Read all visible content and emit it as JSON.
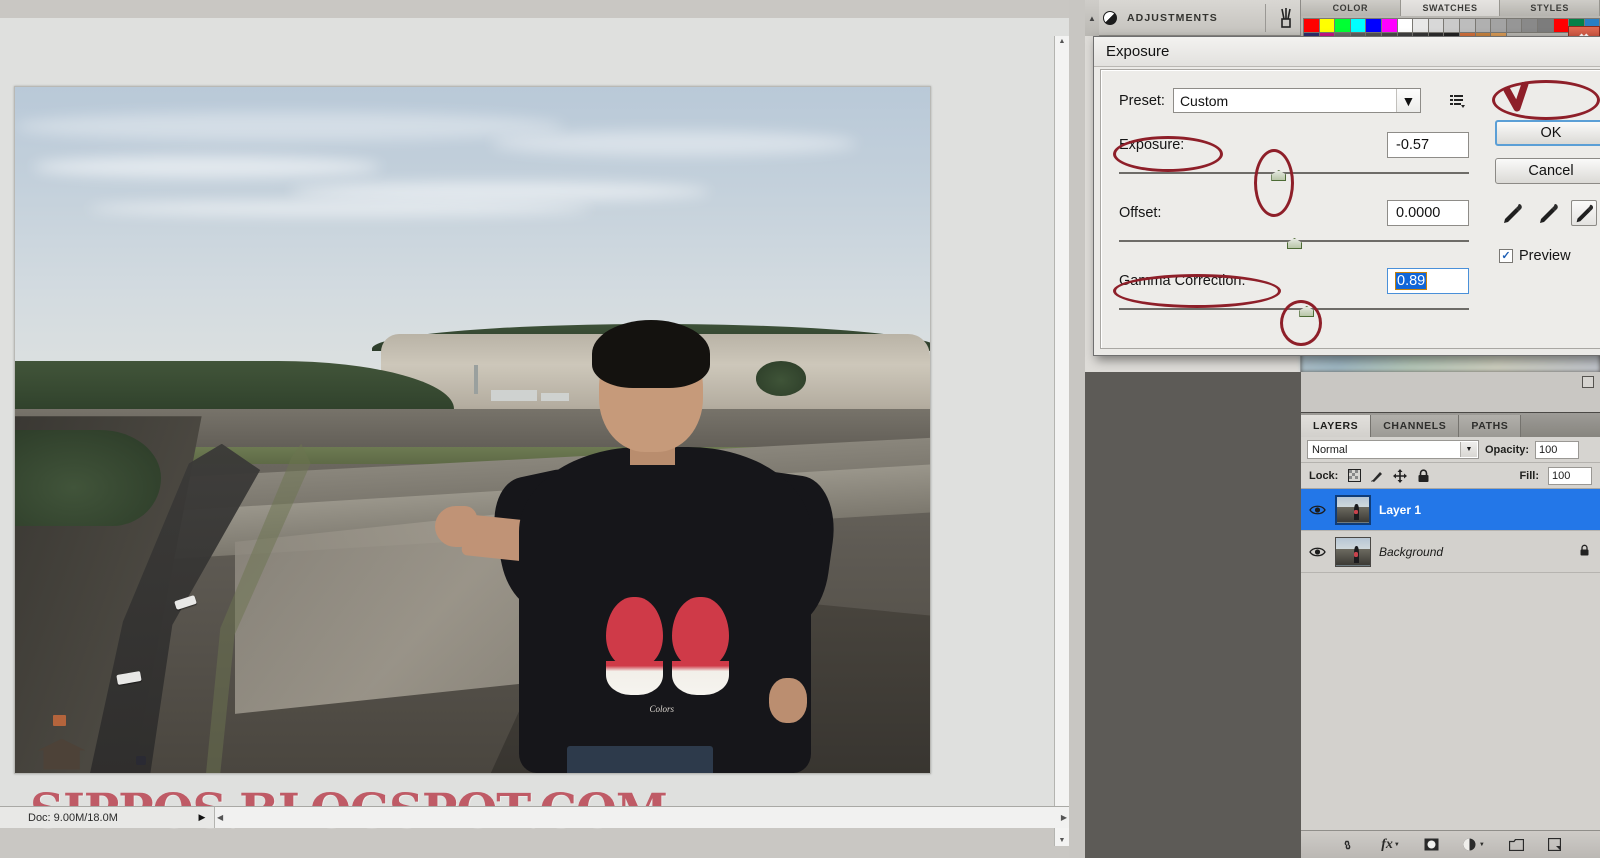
{
  "app": {
    "name": "Adobe Photoshop",
    "canvas_bg": "#c9c7c3"
  },
  "document": {
    "status_text": "Doc: 9.00M/18.0M",
    "status_arrow": "▶",
    "hscroll_left_arrow": "◀",
    "hscroll_right_arrow": "▶",
    "vscroll_up_arrow": "▲",
    "vscroll_down_arrow": "▼",
    "watermark": "SIPPOS.BLOGSPOT.COM",
    "photo_description": "Photo of a man in a black t-shirt with a red and white heart graphic standing in a limestone quarry with a winding road"
  },
  "photo": {
    "shirt_signature": "Colors"
  },
  "adjustments_strip": {
    "label": "ADJUSTMENTS",
    "icon": "half-circle-adjustment-icon",
    "brush_icon": "brush-preset-icon",
    "scroll_arrow": "▲"
  },
  "swatch_dock": {
    "tabs": [
      {
        "label": "COLOR",
        "active": false
      },
      {
        "label": "SWATCHES",
        "active": true
      },
      {
        "label": "STYLES",
        "active": false
      }
    ],
    "swatches": [
      "#ff0000",
      "#ffff00",
      "#00ff33",
      "#00ffff",
      "#0000ff",
      "#ff00ff",
      "#ffffff",
      "#e8e8e8",
      "#d8d8d8",
      "#cacaca",
      "#bdbdbd",
      "#b0b0b0",
      "#a3a3a3",
      "#969696",
      "#898989",
      "#7c7c7c",
      "#ff0000",
      "#048048",
      "#2a7fc4",
      "#2e2e6e",
      "#c71585",
      "#6b6b6b",
      "#5f5f5f",
      "#545454",
      "#4a4a4a",
      "#404040",
      "#363636",
      "#2c2c2c",
      "#222222",
      "#d2703c",
      "#c8833f",
      "#d89a55"
    ]
  },
  "close_button": {
    "label": "✖"
  },
  "exposure_dialog": {
    "title": "Exposure",
    "preset": {
      "label": "Preset:",
      "value": "Custom",
      "caret": "▼",
      "menu_icon": "preset-options-icon"
    },
    "controls": [
      {
        "name": "exposure",
        "label": "Exposure:",
        "value": "-0.57",
        "thumb_pct": 45.5,
        "focused": false,
        "circled_label": true,
        "circled_thumb": true
      },
      {
        "name": "offset",
        "label": "Offset:",
        "value": "0.0000",
        "thumb_pct": 50.0,
        "focused": false,
        "circled_label": false,
        "circled_thumb": false
      },
      {
        "name": "gamma_correction",
        "label": "Gamma Correction:",
        "value": "0.89",
        "thumb_pct": 53.5,
        "focused": true,
        "circled_label": true,
        "circled_thumb": true
      }
    ],
    "buttons": {
      "ok": "OK",
      "cancel": "Cancel"
    },
    "eyedroppers": [
      {
        "name": "set-black-point-eyedropper",
        "selected": false
      },
      {
        "name": "set-gray-point-eyedropper",
        "selected": false
      },
      {
        "name": "set-white-point-eyedropper",
        "selected": true
      }
    ],
    "preview": {
      "label": "Preview",
      "checked": true,
      "check_glyph": "✓"
    }
  },
  "layers_panel": {
    "tabs": [
      {
        "label": "LAYERS",
        "active": true
      },
      {
        "label": "CHANNELS",
        "active": false
      },
      {
        "label": "PATHS",
        "active": false
      }
    ],
    "blend_mode": {
      "value": "Normal",
      "caret": "▼"
    },
    "opacity": {
      "label": "Opacity:",
      "value": "100"
    },
    "fill": {
      "label": "Fill:",
      "value": "100"
    },
    "lock": {
      "label": "Lock:",
      "icons": [
        "lock-transparent-pixels-icon",
        "lock-image-pixels-icon",
        "lock-position-icon",
        "lock-all-icon"
      ]
    },
    "layers": [
      {
        "name": "Layer 1",
        "selected": true,
        "visible": true,
        "italic": false,
        "locked": false
      },
      {
        "name": "Background",
        "selected": false,
        "visible": true,
        "italic": true,
        "locked": true
      }
    ],
    "footer_icons": [
      "link-layers-icon",
      "layer-styles-fx-icon",
      "add-layer-mask-icon",
      "new-adjustment-layer-icon",
      "new-group-icon",
      "new-layer-icon"
    ],
    "footer_glyphs": [
      "⚭",
      "fx",
      "◉",
      "◑",
      "▭",
      "◰"
    ]
  },
  "annotations": {
    "check_mark_color": "#8e1f29",
    "ellipse_color": "#8e1f29",
    "description": "Red hand-drawn ellipses highlighting the Exposure label, Exposure slider thumb, Gamma Correction label, Gamma Correction slider thumb, and the OK button"
  }
}
